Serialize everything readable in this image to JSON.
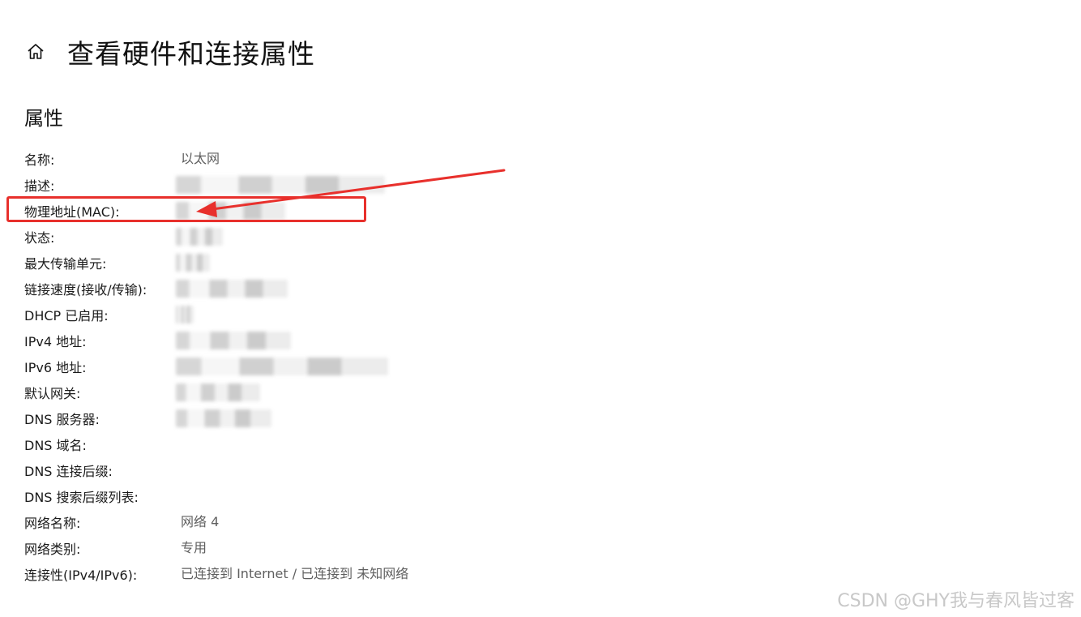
{
  "header": {
    "title": "查看硬件和连接属性"
  },
  "section": {
    "title": "属性"
  },
  "properties": [
    {
      "label": "名称:",
      "value": "以太网"
    },
    {
      "label": "描述:",
      "value": "",
      "redacted": true
    },
    {
      "label": "物理地址(MAC):",
      "value": "",
      "redacted": true
    },
    {
      "label": "状态:",
      "value": "",
      "redacted": true
    },
    {
      "label": "最大传输单元:",
      "value": "",
      "redacted": true
    },
    {
      "label": "链接速度(接收/传输):",
      "value": "",
      "redacted": true
    },
    {
      "label": "DHCP 已启用:",
      "value": "",
      "redacted": true
    },
    {
      "label": "IPv4 地址:",
      "value": "",
      "redacted": true
    },
    {
      "label": "IPv6 地址:",
      "value": "",
      "redacted": true
    },
    {
      "label": "默认网关:",
      "value": "",
      "redacted": true
    },
    {
      "label": "DNS 服务器:",
      "value": "",
      "redacted": true
    },
    {
      "label": "DNS 域名:",
      "value": ""
    },
    {
      "label": "DNS 连接后缀:",
      "value": ""
    },
    {
      "label": "DNS 搜索后缀列表:",
      "value": ""
    },
    {
      "label": "网络名称:",
      "value": "网络 4"
    },
    {
      "label": "网络类别:",
      "value": "专用"
    },
    {
      "label": "连接性(IPv4/IPv6):",
      "value": "已连接到 Internet / 已连接到 未知网络"
    }
  ],
  "watermark": "CSDN @GHY我与春风皆过客",
  "colors": {
    "annotation": "#e8302c",
    "text": "#1b1b1b",
    "value_text": "#5f5f5f"
  }
}
